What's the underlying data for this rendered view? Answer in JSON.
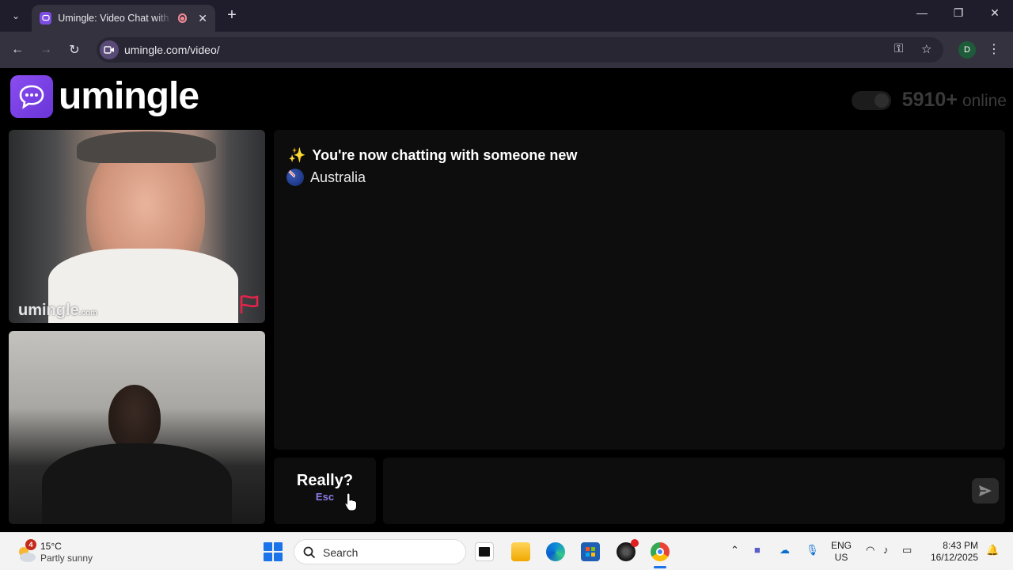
{
  "browser": {
    "tab_title": "Umingle: Video Chat with Strangers",
    "url": "umingle.com/video/",
    "profile_initial": "D"
  },
  "app": {
    "logo_text": "umingle",
    "online_count": "5910+",
    "online_label": "online",
    "watermark_main": "umingle",
    "watermark_suffix": ".com",
    "accent_color": "#7b4de0"
  },
  "chat": {
    "status_message": "You're now chatting with someone new",
    "country": "Australia"
  },
  "controls": {
    "esc_button_label": "Really?",
    "esc_button_key": "Esc",
    "message_placeholder": ""
  },
  "taskbar": {
    "weather_badge": "4",
    "weather_temp": "15°C",
    "weather_desc": "Partly sunny",
    "search_label": "Search",
    "lang_line1": "ENG",
    "lang_line2": "US",
    "time": "8:43 PM",
    "date": "16/12/2025"
  }
}
